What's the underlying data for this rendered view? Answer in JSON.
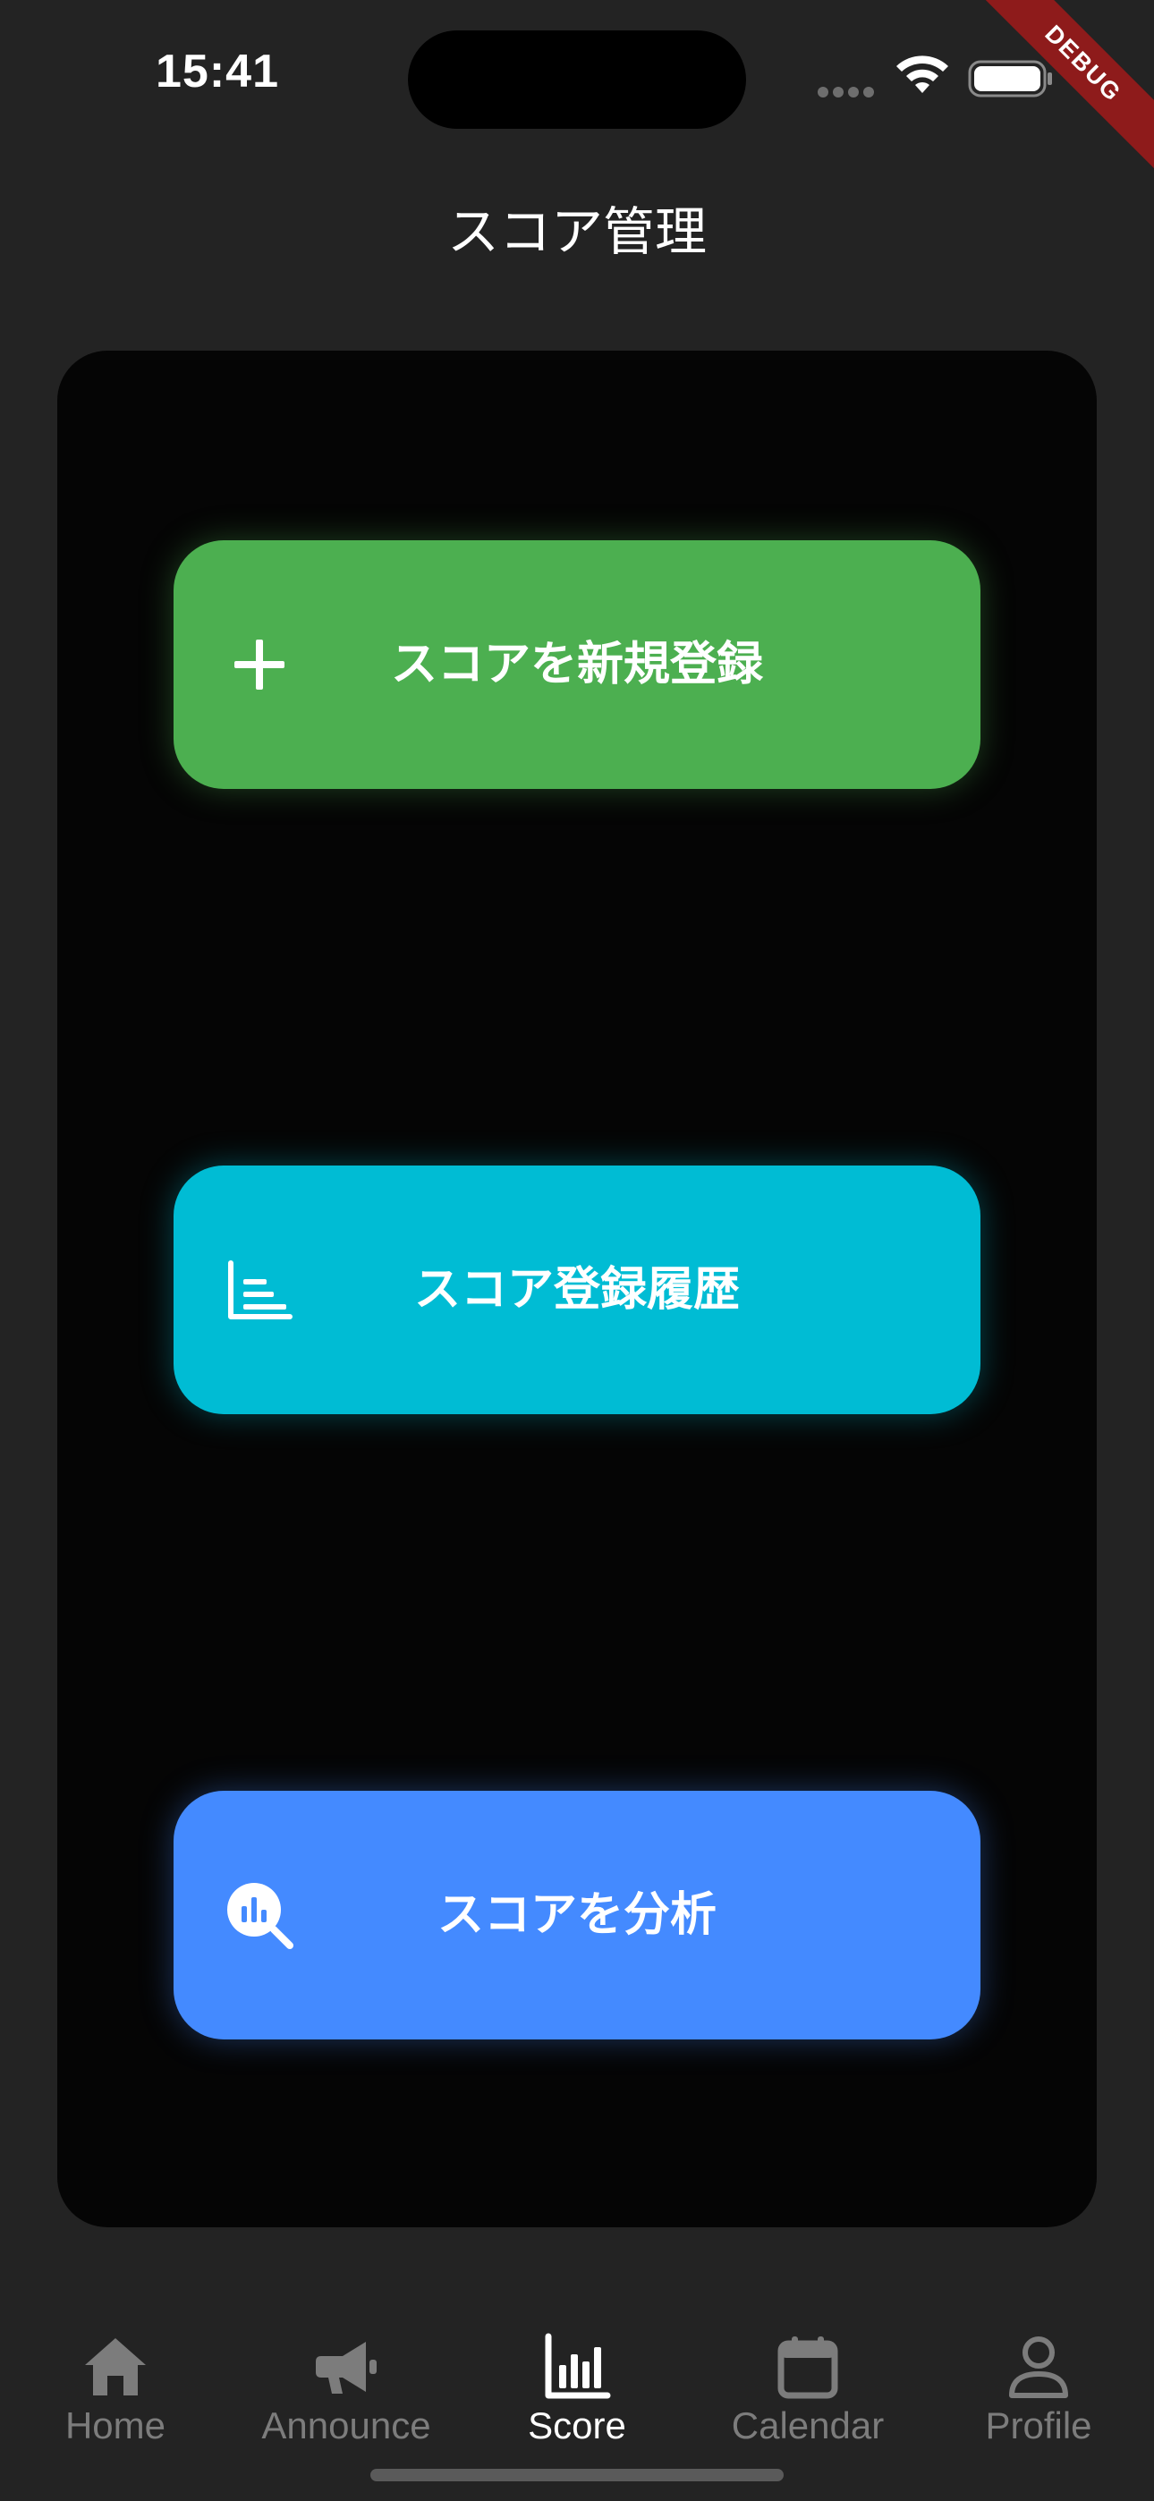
{
  "status_bar": {
    "time": "15:41"
  },
  "debug_banner": "DEBUG",
  "app_bar": {
    "title": "スコア管理"
  },
  "actions": [
    {
      "label": "スコアを新規登録",
      "icon": "add-icon",
      "color": "#4CAF50"
    },
    {
      "label": "スコア登録履歴",
      "icon": "list-chart-icon",
      "color": "#00BCD4"
    },
    {
      "label": "スコアを分析",
      "icon": "query-stats-icon",
      "color": "#448AFF"
    }
  ],
  "bottom_nav": {
    "active": "Score",
    "items": [
      {
        "label": "Home",
        "icon": "home-icon"
      },
      {
        "label": "Announce",
        "icon": "megaphone-icon"
      },
      {
        "label": "Score",
        "icon": "bar-chart-icon"
      },
      {
        "label": "Calendar",
        "icon": "calendar-icon"
      },
      {
        "label": "Profile",
        "icon": "person-icon"
      }
    ]
  },
  "colors": {
    "background": "#232323",
    "card": "#050505",
    "nav_inactive": "#7C7C7C",
    "nav_active": "#FFFFFF",
    "debug_ribbon": "#8E1B1B"
  }
}
